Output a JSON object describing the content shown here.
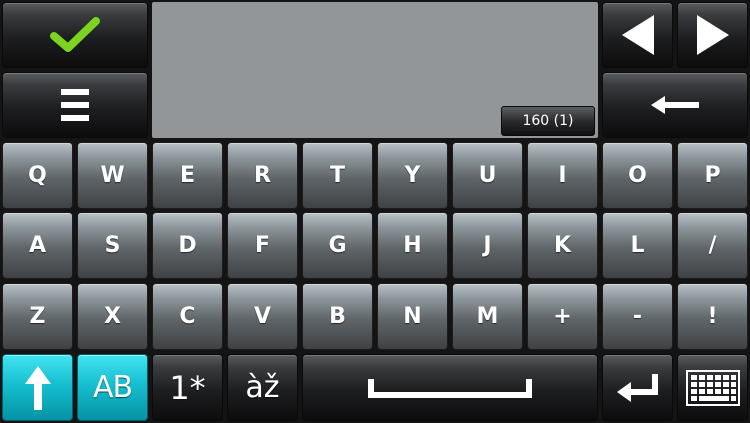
{
  "keyboard": {
    "rows": [
      [
        "Q",
        "W",
        "E",
        "R",
        "T",
        "Y",
        "U",
        "I",
        "O",
        "P"
      ],
      [
        "A",
        "S",
        "D",
        "F",
        "G",
        "H",
        "J",
        "K",
        "L",
        "/"
      ],
      [
        "Z",
        "X",
        "C",
        "V",
        "B",
        "N",
        "M",
        "+",
        "-",
        "!"
      ]
    ],
    "case_label": "AB",
    "numbers_label": "1*",
    "accents_label": "àž"
  },
  "display": {
    "char_counter": "160 (1)"
  },
  "icons": {
    "ok": "check-icon",
    "menu": "menu-icon",
    "left": "arrow-left-icon",
    "right": "arrow-right-icon",
    "backspace": "backspace-icon",
    "shift": "shift-icon",
    "space": "space-icon",
    "enter": "enter-icon",
    "keyboard": "keyboard-icon"
  },
  "colors": {
    "check": "#7dd321",
    "shift_active": "#15bfd0",
    "display_bg": "#939698"
  }
}
